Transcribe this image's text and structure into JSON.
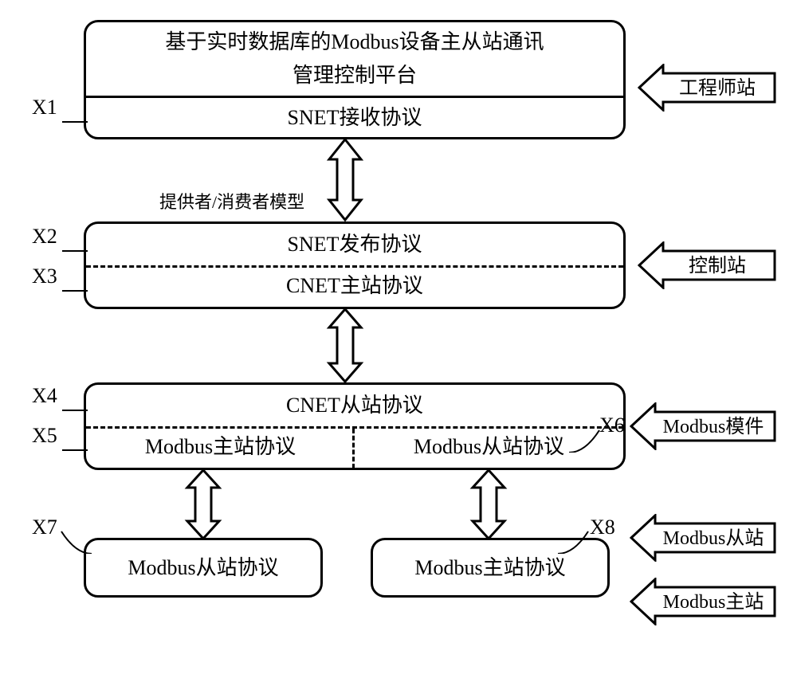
{
  "boxes": {
    "top": {
      "title_line1": "基于实时数据库的Modbus设备主从站通讯",
      "title_line2": "管理控制平台",
      "snet_recv": "SNET接收协议"
    },
    "middle": {
      "snet_pub": "SNET发布协议",
      "cnet_master": "CNET主站协议"
    },
    "modbus_module": {
      "cnet_slave": "CNET从站协议",
      "modbus_master": "Modbus主站协议",
      "modbus_slave": "Modbus从站协议"
    },
    "bottom_left": "Modbus从站协议",
    "bottom_right": "Modbus主站协议"
  },
  "labels": {
    "x1": "X1",
    "x2": "X2",
    "x3": "X3",
    "x4": "X4",
    "x5": "X5",
    "x6": "X6",
    "x7": "X7",
    "x8": "X8"
  },
  "model_label": "提供者/消费者模型",
  "side_arrows": {
    "engineer": "工程师站",
    "control": "控制站",
    "modbus_module": "Modbus模件",
    "modbus_slave": "Modbus从站",
    "modbus_master": "Modbus主站"
  }
}
